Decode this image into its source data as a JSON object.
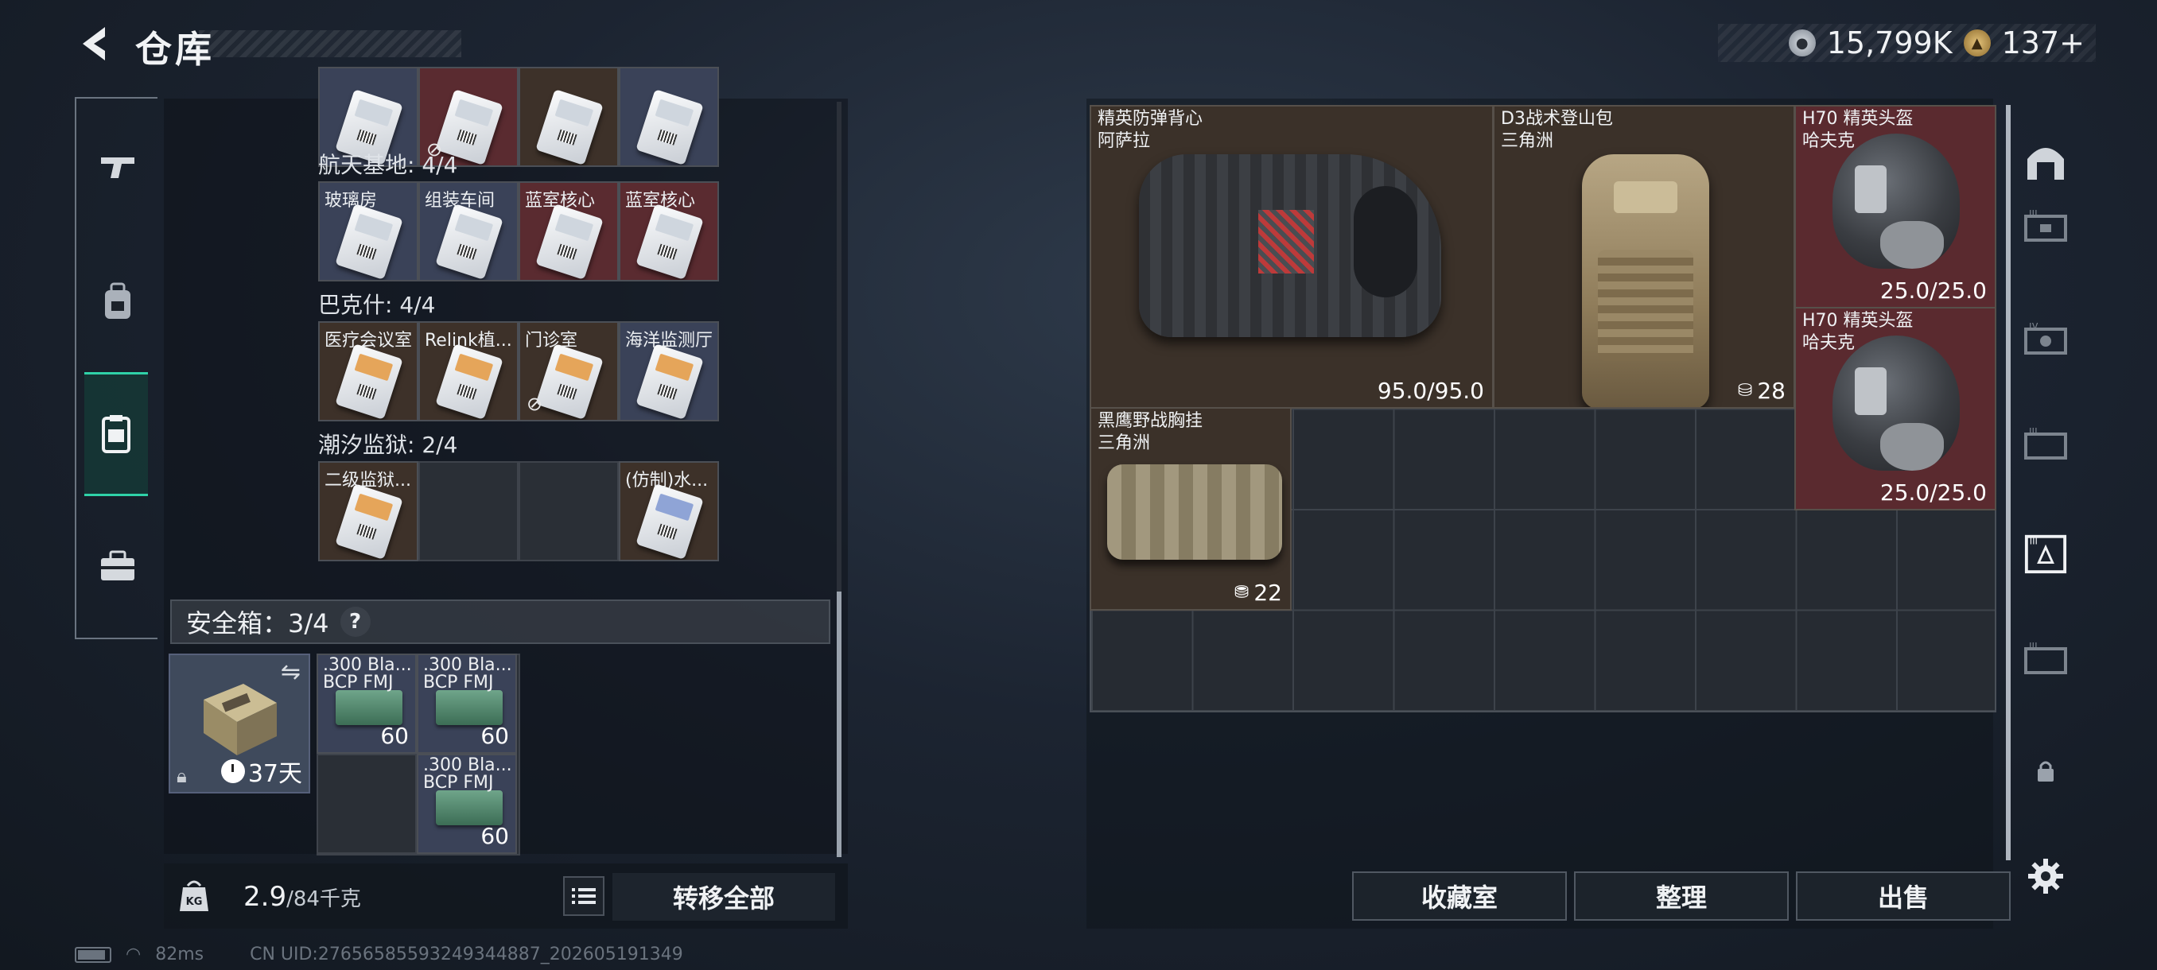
{
  "header": {
    "title": "仓库",
    "currency": [
      {
        "icon": "silver-coin-icon",
        "value": "15,799K"
      },
      {
        "icon": "gold-coin-icon",
        "value": "137+"
      }
    ]
  },
  "left_nav": [
    {
      "name": "weapons",
      "icon": "gun-icon",
      "active": false
    },
    {
      "name": "armor",
      "icon": "backpack-icon",
      "active": false
    },
    {
      "name": "keys",
      "icon": "keycard-icon",
      "active": true
    },
    {
      "name": "misc",
      "icon": "toolbox-icon",
      "active": false
    }
  ],
  "storage": {
    "sections": [
      {
        "label": "航天基地: 4/4",
        "items": [
          {
            "name": "玻璃房",
            "bg": "blue"
          },
          {
            "name": "组装车间",
            "bg": "blue"
          },
          {
            "name": "蓝室核心",
            "bg": "red"
          },
          {
            "name": "蓝室核心",
            "bg": "red"
          }
        ]
      },
      {
        "label": "巴克什: 4/4",
        "items": [
          {
            "name": "医疗会议室",
            "bg": "brown"
          },
          {
            "name": "Relink植...",
            "bg": "brown"
          },
          {
            "name": "门诊室",
            "bg": "brown"
          },
          {
            "name": "海洋监测厅",
            "bg": "blue"
          }
        ]
      },
      {
        "label": "潮汐监狱: 2/4",
        "items": [
          {
            "name": "二级监狱...",
            "bg": "brown"
          },
          {
            "name": "",
            "bg": "empty"
          },
          {
            "name": "",
            "bg": "empty"
          },
          {
            "name": "(仿制)水...",
            "bg": "brown"
          }
        ]
      }
    ]
  },
  "safe_box": {
    "label": "安全箱：3/4",
    "help": "?",
    "days": "37天",
    "items": [
      {
        "name": ".300 Bla...\nBCP FMJ",
        "count": "60"
      },
      {
        "name": ".300 Bla...\nBCP FMJ",
        "count": "60"
      },
      {
        "name": ".300 Bla...\nBCP FMJ",
        "count": "60"
      }
    ]
  },
  "footer_left": {
    "weight_value": "2.9",
    "weight_capacity": "/84千克",
    "transfer_all": "转移全部"
  },
  "status": {
    "ping": "82ms",
    "uid": "CN UID:27656585593249344887_202605191349"
  },
  "equipment": [
    {
      "name": "精英防弹背心\n阿萨拉",
      "stat": "95.0/95.0",
      "type": "vest",
      "bg": "brown"
    },
    {
      "name": "D3战术登山包\n三角洲",
      "stat": "28",
      "stat_icon": "lock-bag-icon",
      "type": "backpack",
      "bg": "brown"
    },
    {
      "name": "H70 精英头盔\n哈夫克",
      "stat": "25.0/25.0",
      "type": "helmet",
      "bg": "red"
    },
    {
      "name": "H70 精英头盔\n哈夫克",
      "stat": "25.0/25.0",
      "type": "helmet",
      "bg": "red"
    },
    {
      "name": "黑鹰野战胸挂\n三角洲",
      "stat": "22",
      "stat_icon": "vest-slot-icon",
      "type": "rig",
      "bg": "brown"
    }
  ],
  "bottom_buttons": {
    "collection": "收藏室",
    "sort": "整理",
    "sell": "出售"
  },
  "right_nav": [
    "arch-icon",
    "level-3-case-icon",
    "level-4-case-icon",
    "level-3-case-icon",
    "level-3-selected-case-icon",
    "level-3-case-icon",
    "lock-icon",
    "settings-gear-icon"
  ],
  "colors": {
    "accent": "#2fd2a8",
    "slot_brown": "#3d3129",
    "slot_red": "#5a2b30",
    "slot_blue": "#3a4258"
  }
}
